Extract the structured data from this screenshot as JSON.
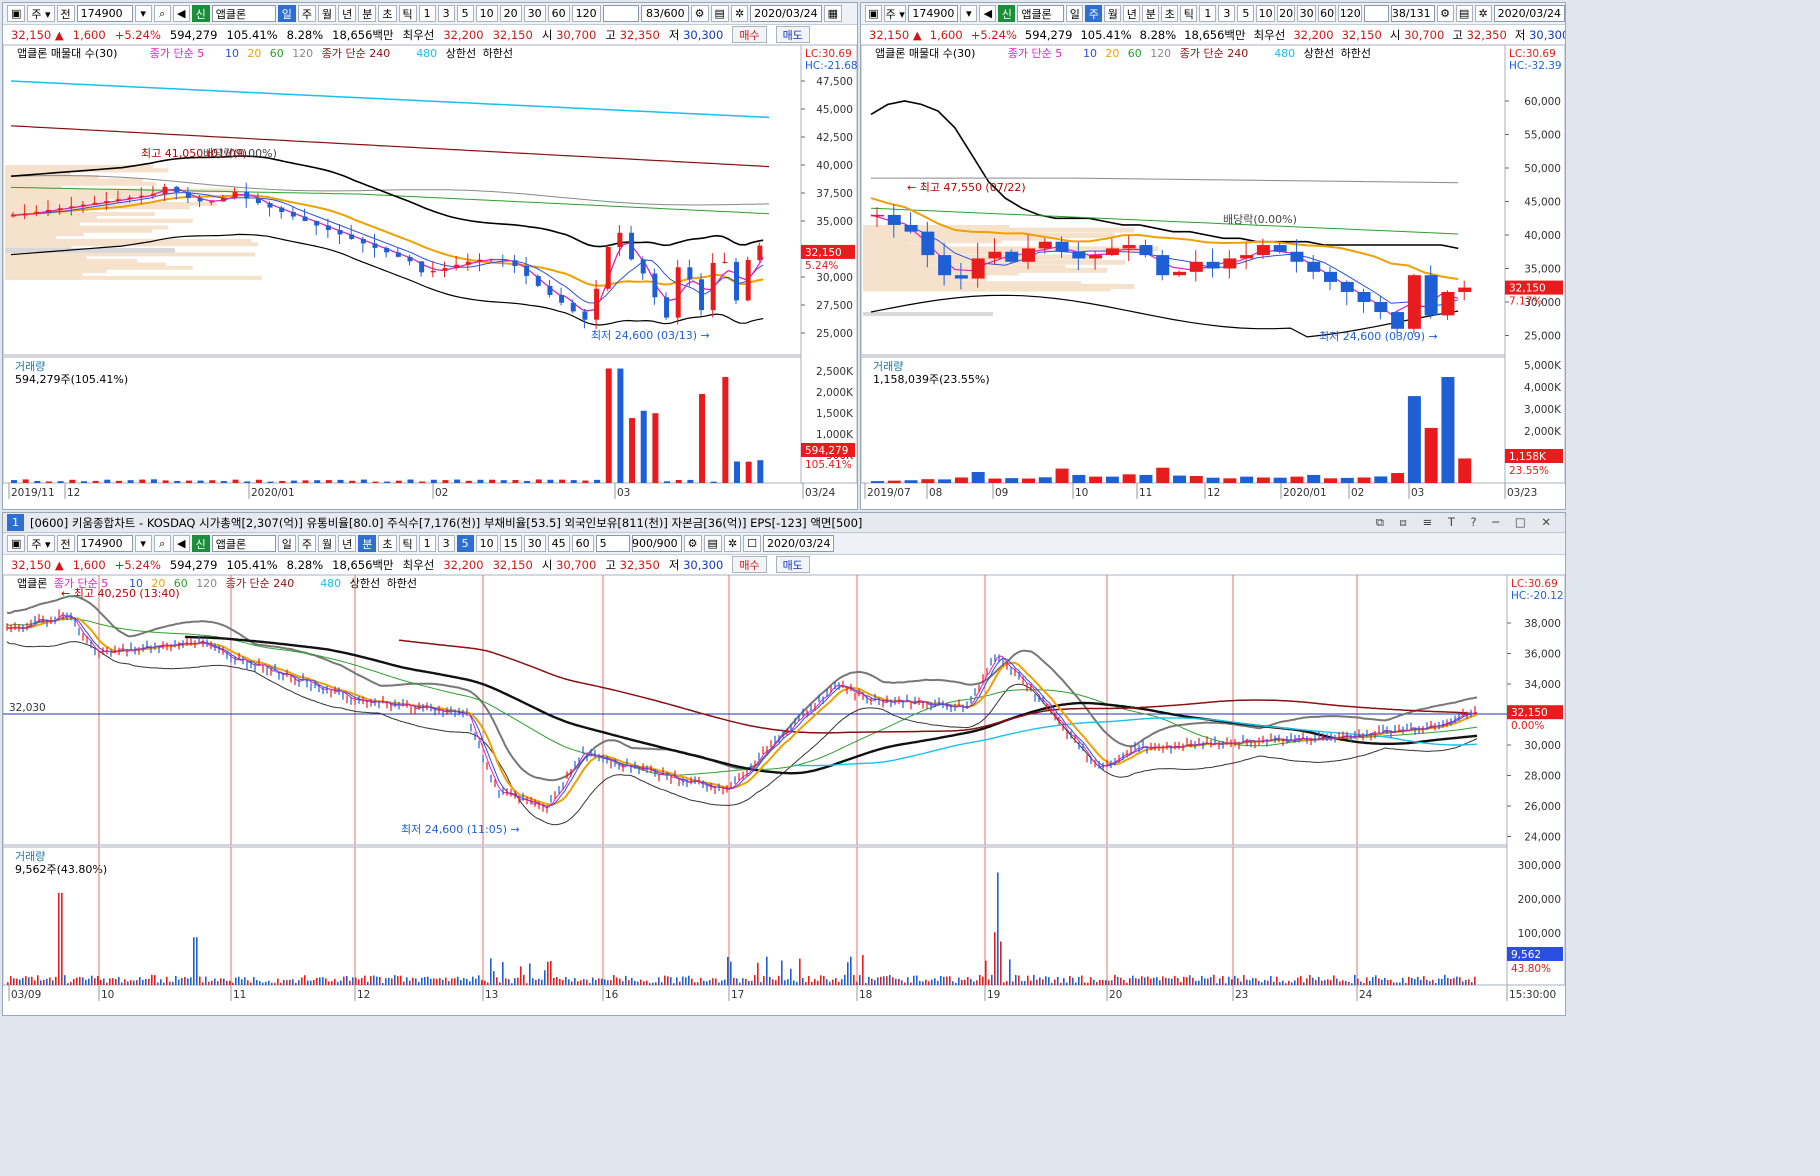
{
  "common": {
    "code": "174900",
    "name": "앱클론",
    "name_badge": "신",
    "date": "2020/03/24",
    "quote": {
      "price": "32,150",
      "arrow": "▲",
      "change": "1,600",
      "change_pct": "+5.24%",
      "volume": "594,279",
      "vol_ratio": "105.41%",
      "turnover": "8.28%",
      "amount": "18,656백만",
      "best_label": "최우선",
      "best_ask": "32,200",
      "best_bid": "32,150",
      "open_label": "시",
      "open": "30,700",
      "high_label": "고",
      "high": "32,350",
      "low_label": "저",
      "low": "30,300",
      "buy": "매수",
      "sell": "매도"
    },
    "period_tabs": [
      "일",
      "주",
      "월",
      "년",
      "분",
      "초",
      "틱"
    ],
    "num_tabs": [
      "1",
      "3",
      "5",
      "10",
      "20",
      "30",
      "60",
      "120"
    ]
  },
  "win1": {
    "counter": "83/600",
    "legend": [
      "앱클론 매물대 수(30)",
      "종가 단순 5",
      "10",
      "20",
      "60",
      "120",
      "종가 단순 240",
      "480",
      "상한선",
      "하한선"
    ],
    "lc": "LC:30.69",
    "hc": "HC:-21.68",
    "y_ticks": [
      "47,500",
      "45,000",
      "42,500",
      "40,000",
      "37,500",
      "35,000",
      "32,500",
      "30,000",
      "27,500",
      "25,000"
    ],
    "price_tag": "32,150",
    "pct_tag": "5.24%",
    "high_note": "최고 41,050 (01/09)",
    "div_note": "배당락(0.00%)",
    "low_note": "최저 24,600 (03/13)",
    "vol_title": "거래량",
    "vol_value": "594,279주(105.41%)",
    "vol_ticks": [
      "2,500K",
      "2,000K",
      "1,500K",
      "1,000K",
      "500K"
    ],
    "vol_tag": "594,279",
    "vol_tag2": "105.41%",
    "x_labels": [
      "2019/11",
      "12",
      "2020/01",
      "02",
      "03",
      "03/24"
    ]
  },
  "win2": {
    "counter": "38/131",
    "legend": [
      "앱클론 매물대 수(30)",
      "종가 단순 5",
      "10",
      "20",
      "60",
      "120",
      "종가 단순 240",
      "480",
      "상한선",
      "하한선"
    ],
    "lc": "LC:30.69",
    "hc": "HC:-32.39",
    "y_ticks": [
      "60,000",
      "55,000",
      "50,000",
      "45,000",
      "40,000",
      "35,000",
      "30,000",
      "25,000"
    ],
    "price_tag": "32,150",
    "pct_tag": "7.17%",
    "high_note": "최고 47,550 (07/22)",
    "div_note": "배당락(0.00%)",
    "low_note": "최저 24,600 (03/09)",
    "vol_title": "거래량",
    "vol_value": "1,158,039주(23.55%)",
    "vol_ticks": [
      "5,000K",
      "4,000K",
      "3,000K",
      "2,000K",
      "1,000K"
    ],
    "vol_tag": "1,158K",
    "vol_tag2": "23.55%",
    "x_labels": [
      "2019/07",
      "08",
      "09",
      "10",
      "11",
      "12",
      "2020/01",
      "02",
      "03",
      "03/23"
    ]
  },
  "win3": {
    "title": "[0600] 키움종합차트 - KOSDAQ 시가총액[2,307(억)] 유통비율[80.0] 주식수[7,176(천)] 부채비율[53.5] 외국인보유[811(천)] 자본금[36(억)] EPS[-123] 액면[500]",
    "window_no": "1",
    "counter": "900/900",
    "min_value": "5",
    "legend": [
      "앱클론",
      "종가 단순 5",
      "10",
      "20",
      "60",
      "120",
      "종가 단순 240",
      "480",
      "상한선",
      "하한선"
    ],
    "lc": "LC:30.69",
    "hc": "HC:-20.12",
    "y_ticks": [
      "38,000",
      "36,000",
      "34,000",
      "32,000",
      "30,000",
      "28,000",
      "26,000",
      "24,000"
    ],
    "hline_label": "32,030",
    "price_tag": "32,150",
    "pct_tag": "0.00%",
    "high_note": "최고 40,250 (13:40)",
    "low_note": "최저 24,600 (11:05)",
    "vol_title": "거래량",
    "vol_value": "9,562주(43.80%)",
    "vol_ticks": [
      "300,000",
      "200,000",
      "100,000"
    ],
    "vol_tag": "9,562",
    "vol_tag2": "43.80%",
    "x_labels": [
      "03/09",
      "10",
      "11",
      "12",
      "13",
      "16",
      "17",
      "18",
      "19",
      "20",
      "23",
      "24",
      "15:30:00"
    ]
  },
  "colors": {
    "up": "#e81c1c",
    "down": "#1f5fd6",
    "ma5": "#e020c0",
    "ma10": "#2a4fe0",
    "ma20": "#f0a000",
    "ma60": "#2ca02c",
    "ma120": "#888888",
    "ma240": "#8b1010",
    "ma480": "#18c0f0",
    "band": "#000000"
  }
}
